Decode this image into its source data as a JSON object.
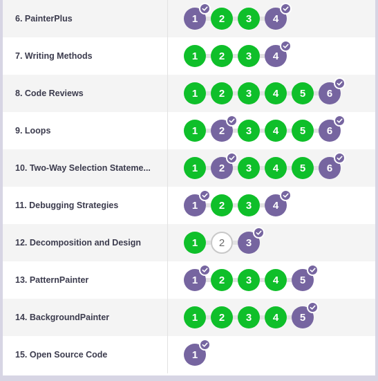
{
  "rows": [
    {
      "label": "6. PainterPlus",
      "levels": [
        {
          "n": "1",
          "status": "assessment",
          "check": true
        },
        {
          "n": "2",
          "status": "perfect",
          "check": false
        },
        {
          "n": "3",
          "status": "perfect",
          "check": false
        },
        {
          "n": "4",
          "status": "assessment",
          "check": true
        }
      ]
    },
    {
      "label": "7. Writing Methods",
      "levels": [
        {
          "n": "1",
          "status": "perfect",
          "check": false
        },
        {
          "n": "2",
          "status": "perfect",
          "check": false
        },
        {
          "n": "3",
          "status": "perfect",
          "check": false
        },
        {
          "n": "4",
          "status": "assessment",
          "check": true
        }
      ]
    },
    {
      "label": "8. Code Reviews",
      "levels": [
        {
          "n": "1",
          "status": "perfect",
          "check": false
        },
        {
          "n": "2",
          "status": "perfect",
          "check": false
        },
        {
          "n": "3",
          "status": "perfect",
          "check": false
        },
        {
          "n": "4",
          "status": "perfect",
          "check": false
        },
        {
          "n": "5",
          "status": "perfect",
          "check": false
        },
        {
          "n": "6",
          "status": "assessment",
          "check": true
        }
      ]
    },
    {
      "label": "9. Loops",
      "levels": [
        {
          "n": "1",
          "status": "perfect",
          "check": false
        },
        {
          "n": "2",
          "status": "assessment",
          "check": true
        },
        {
          "n": "3",
          "status": "perfect",
          "check": false
        },
        {
          "n": "4",
          "status": "perfect",
          "check": false
        },
        {
          "n": "5",
          "status": "perfect",
          "check": false
        },
        {
          "n": "6",
          "status": "assessment",
          "check": true
        }
      ]
    },
    {
      "label": "10. Two-Way Selection Stateme...",
      "levels": [
        {
          "n": "1",
          "status": "perfect",
          "check": false
        },
        {
          "n": "2",
          "status": "assessment",
          "check": true
        },
        {
          "n": "3",
          "status": "perfect",
          "check": false
        },
        {
          "n": "4",
          "status": "perfect",
          "check": false
        },
        {
          "n": "5",
          "status": "perfect",
          "check": false
        },
        {
          "n": "6",
          "status": "assessment",
          "check": true
        }
      ]
    },
    {
      "label": "11. Debugging Strategies",
      "levels": [
        {
          "n": "1",
          "status": "assessment",
          "check": true
        },
        {
          "n": "2",
          "status": "perfect",
          "check": false
        },
        {
          "n": "3",
          "status": "perfect",
          "check": false
        },
        {
          "n": "4",
          "status": "assessment",
          "check": true
        }
      ]
    },
    {
      "label": "12. Decomposition and Design",
      "levels": [
        {
          "n": "1",
          "status": "perfect",
          "check": false
        },
        {
          "n": "2",
          "status": "notstarted",
          "check": false
        },
        {
          "n": "3",
          "status": "assessment",
          "check": true
        }
      ]
    },
    {
      "label": "13. PatternPainter",
      "levels": [
        {
          "n": "1",
          "status": "assessment",
          "check": true
        },
        {
          "n": "2",
          "status": "perfect",
          "check": false
        },
        {
          "n": "3",
          "status": "perfect",
          "check": false
        },
        {
          "n": "4",
          "status": "perfect",
          "check": false
        },
        {
          "n": "5",
          "status": "assessment",
          "check": true
        }
      ]
    },
    {
      "label": "14. BackgroundPainter",
      "levels": [
        {
          "n": "1",
          "status": "perfect",
          "check": false
        },
        {
          "n": "2",
          "status": "perfect",
          "check": false
        },
        {
          "n": "3",
          "status": "perfect",
          "check": false
        },
        {
          "n": "4",
          "status": "perfect",
          "check": false
        },
        {
          "n": "5",
          "status": "assessment",
          "check": true
        }
      ]
    },
    {
      "label": "15. Open Source Code",
      "levels": [
        {
          "n": "1",
          "status": "assessment",
          "check": true
        }
      ]
    }
  ]
}
